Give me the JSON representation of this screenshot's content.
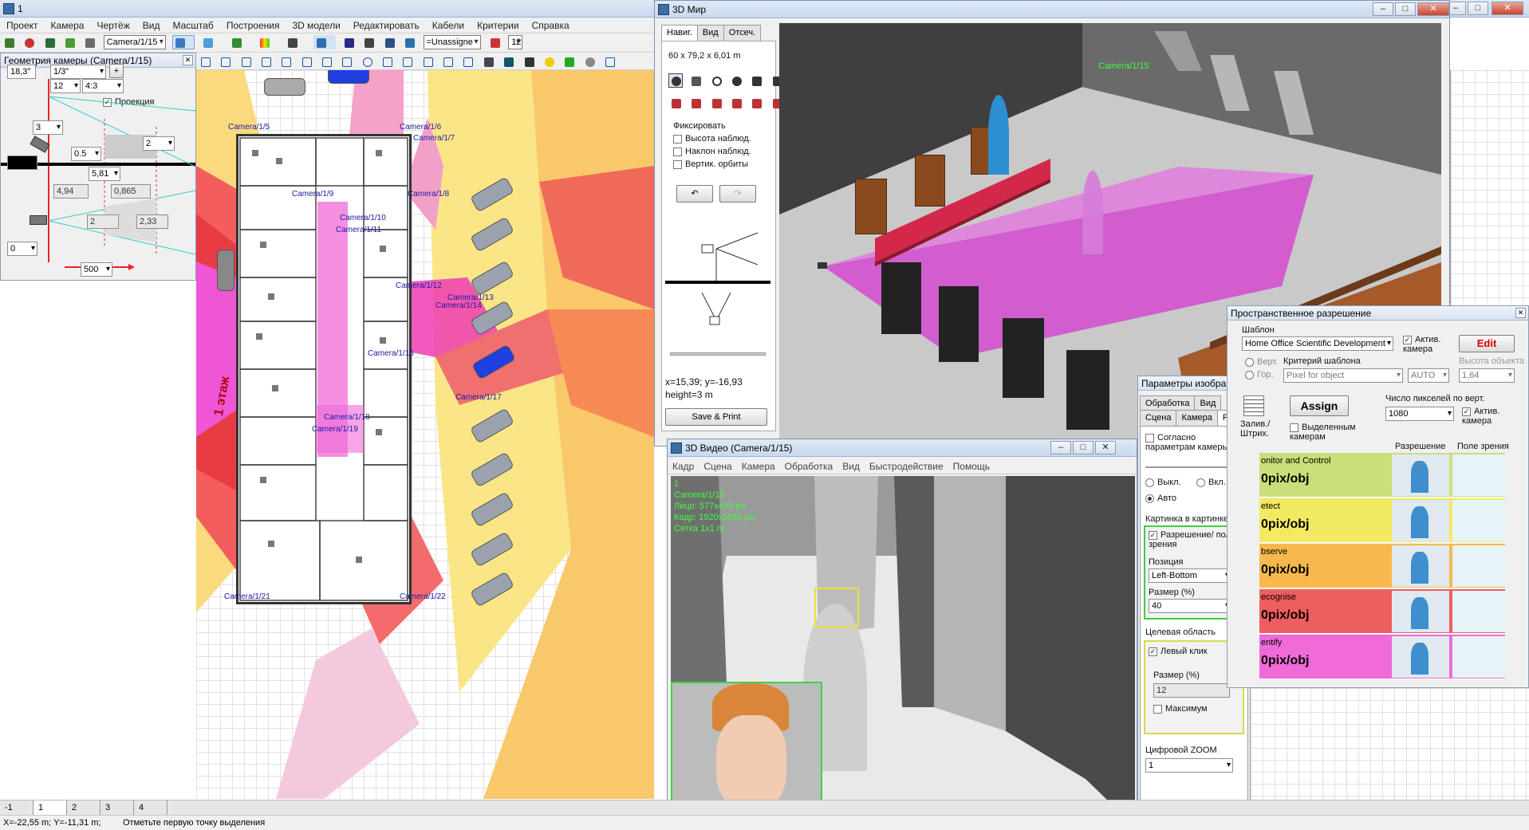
{
  "main_window": {
    "title": "1",
    "menu": [
      "Проект",
      "Камера",
      "Чертёж",
      "Вид",
      "Масштаб",
      "Построения",
      "3D модели",
      "Редактировать",
      "Кабели",
      "Критерии",
      "Справка"
    ],
    "toolbar": {
      "camera_combo": "Camera/1/15",
      "group_combo": "=Unassigne",
      "zoom_value": "12"
    }
  },
  "camera_geometry_panel": {
    "title": "Геометрия камеры (Camera/1/15)",
    "angle": "18,3°",
    "sensor": "1/3\"",
    "focal": "12",
    "aspect": "4:3",
    "projection_label": "Проекция",
    "projection_checked": true,
    "height_value": "3",
    "tilt_value": "2",
    "v05": "0.5",
    "dist": "5,81",
    "left_val": "4,94",
    "right_val": "0,865",
    "w_val": "2",
    "w2_val": "2,33",
    "rot_val": "0",
    "range_val": "500"
  },
  "plan": {
    "floor_label": "1 этаж",
    "camera_labels": [
      "Camera/1/5",
      "Camera/1/6",
      "Camera/1/7",
      "Camera/1/8",
      "Camera/1/9",
      "Camera/1/10",
      "Camera/1/11",
      "Camera/1/12",
      "Camera/1/13",
      "Camera/1/14",
      "Camera/1/16",
      "Camera/1/17",
      "Camera/1/18",
      "Camera/1/19",
      "Camera/1/21",
      "Camera/1/22"
    ]
  },
  "world3d": {
    "title": "3D Мир",
    "tabs": [
      "Навиг.",
      "Вид",
      "Отсеч."
    ],
    "size": "60 x 79,2 x 6,01 m",
    "fix_label": "Фиксировать",
    "checks": [
      "Высота наблюд.",
      "Наклон наблюд.",
      "Вертик. орбиты"
    ],
    "coords": "x=15,39;  y=-16,93",
    "height": "height=3 m",
    "save_print": "Save & Print",
    "scene_camera_label": "Camera/1/15"
  },
  "video3d": {
    "title": "3D Видео (Camera/1/15)",
    "menu": [
      "Кадр",
      "Сцена",
      "Камера",
      "Обработка",
      "Вид",
      "Быстродействие",
      "Помощь"
    ],
    "overlay": [
      "1",
      "Camera/1/15",
      "Лицо: 577x433 pix",
      "Кадр: 1920x1080 pix",
      "Сетка 1x1 m"
    ]
  },
  "image_params": {
    "title": "Параметры изобра...",
    "tabs_row1": [
      "Обработка",
      "Вид"
    ],
    "tabs_row2": [
      "Сцена",
      "Камера",
      "PiP"
    ],
    "by_camera_params": "Согласно параметрам камеры",
    "radio_off": "Выкл.",
    "radio_on": "Вкл.",
    "radio_auto": "Авто",
    "pip_group": "Картинка в картинке",
    "pip_resolution": "Разрешение/ поле зрения",
    "position_label": "Позиция",
    "position_value": "Left-Bottom",
    "size_label": "Размер (%)",
    "size_value": "40",
    "target_group": "Целевая область",
    "left_click": "Левый клик",
    "target_size_label": "Размер (%)",
    "target_size_value": "12",
    "maximum": "Максимум",
    "zoom_label": "Цифровой ZOOM",
    "zoom_value": "1"
  },
  "spatial_resolution": {
    "title": "Пространственное разрешение",
    "template_label": "Шаблон",
    "template_value": "Home Office Scientific Development",
    "active_camera": "Актив. камера",
    "edit": "Edit",
    "vert": "Верт.",
    "hor": "Гор.",
    "criterion_label": "Критерий шаблона",
    "criterion_value": "Pixel for object",
    "auto_value": "AUTO",
    "obj_height_label": "Высота объекта",
    "obj_height_value": "1,64",
    "assign": "Assign",
    "fill_label": "Залив./ Штрих.",
    "selected_cams": "Выделенным камерам",
    "pixels_vert_label": "Число пикселей по верт.",
    "pixels_vert_value": "1080",
    "active_camera2": "Актив. камера",
    "col_resolution": "Разрешение",
    "col_fov": "Поле зрения",
    "rows": [
      {
        "title": "onitor and Control",
        "value": "0pix/obj",
        "color": "#c9e07a"
      },
      {
        "title": "etect",
        "value": "0pix/obj",
        "color": "#f2ea63"
      },
      {
        "title": "bserve",
        "value": "0pix/obj",
        "color": "#f7b94e"
      },
      {
        "title": "ecognise",
        "value": "0pix/obj",
        "color": "#ef5e5e"
      },
      {
        "title": "entify",
        "value": "0pix/obj",
        "color": "#f06ad8"
      }
    ]
  },
  "sheet_tabs": [
    "-1",
    "1",
    "2",
    "3",
    "4"
  ],
  "status": {
    "coords": "X=-22,55 m; Y=-11,31 m;",
    "hint": "Отметьте первую точку выделения"
  }
}
